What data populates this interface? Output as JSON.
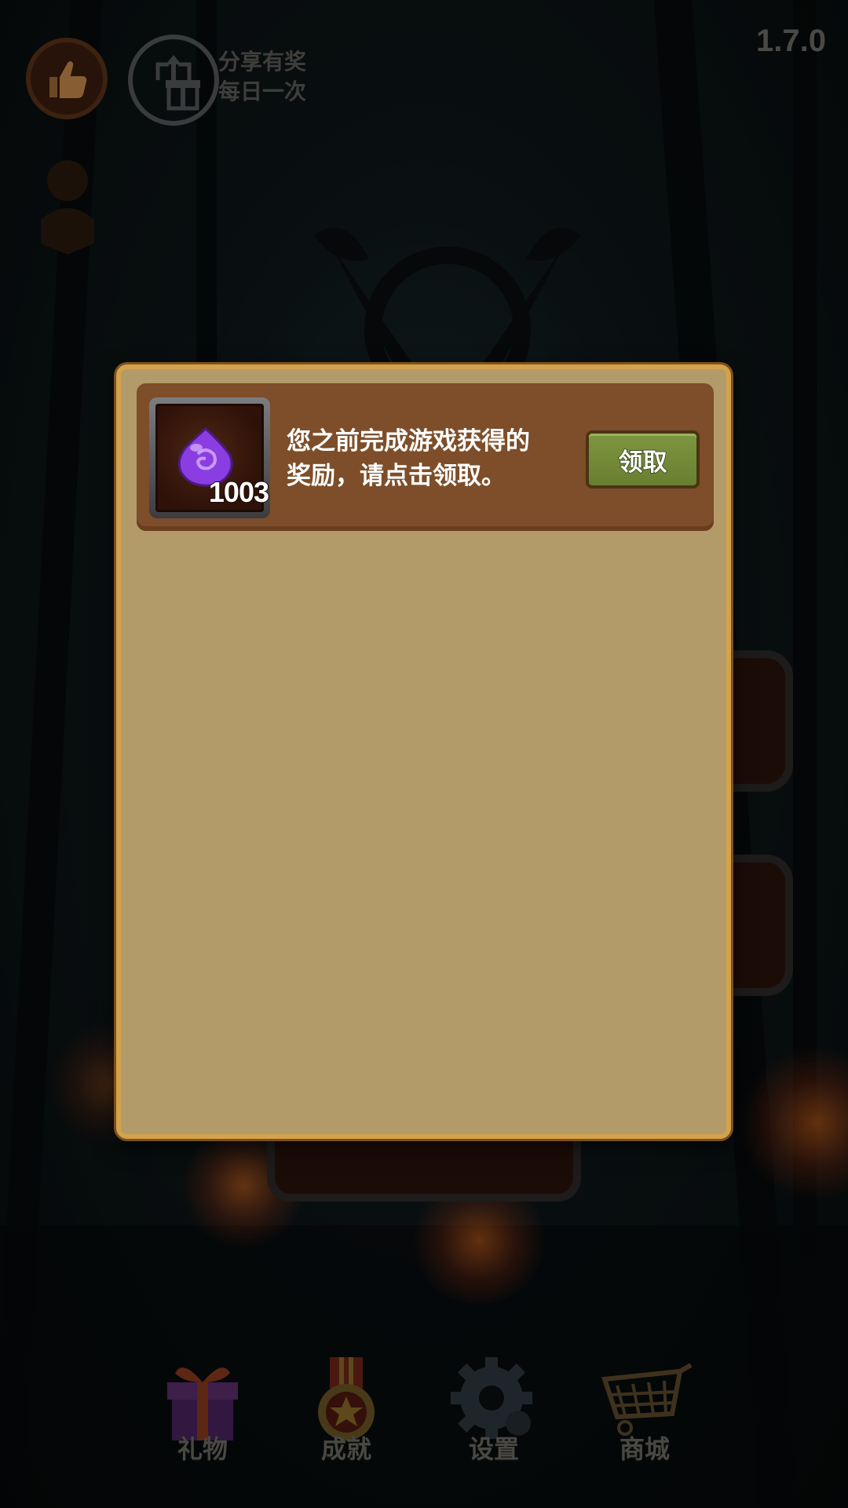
{
  "hud": {
    "version": "1.7.0",
    "share_line1": "分享有奖",
    "share_line2": "每日一次"
  },
  "reward_dialog": {
    "item_icon": "purple-gem-icon",
    "item_count": "1003",
    "message_line1": "您之前完成游戏获得的",
    "message_line2": "奖励，请点击领取。",
    "claim_label": "领取"
  },
  "bottom_nav": {
    "items": [
      {
        "label": "礼物",
        "icon": "gift-box-icon"
      },
      {
        "label": "成就",
        "icon": "medal-icon"
      },
      {
        "label": "设置",
        "icon": "gear-icon"
      },
      {
        "label": "商城",
        "icon": "shopping-cart-icon"
      }
    ]
  },
  "colors": {
    "dialog_bg": "#b39b69",
    "dialog_border": "#d3a24a",
    "reward_row_bg": "#7d4e29",
    "claim_button": "#7e9640",
    "gem": "#8a3de0"
  }
}
